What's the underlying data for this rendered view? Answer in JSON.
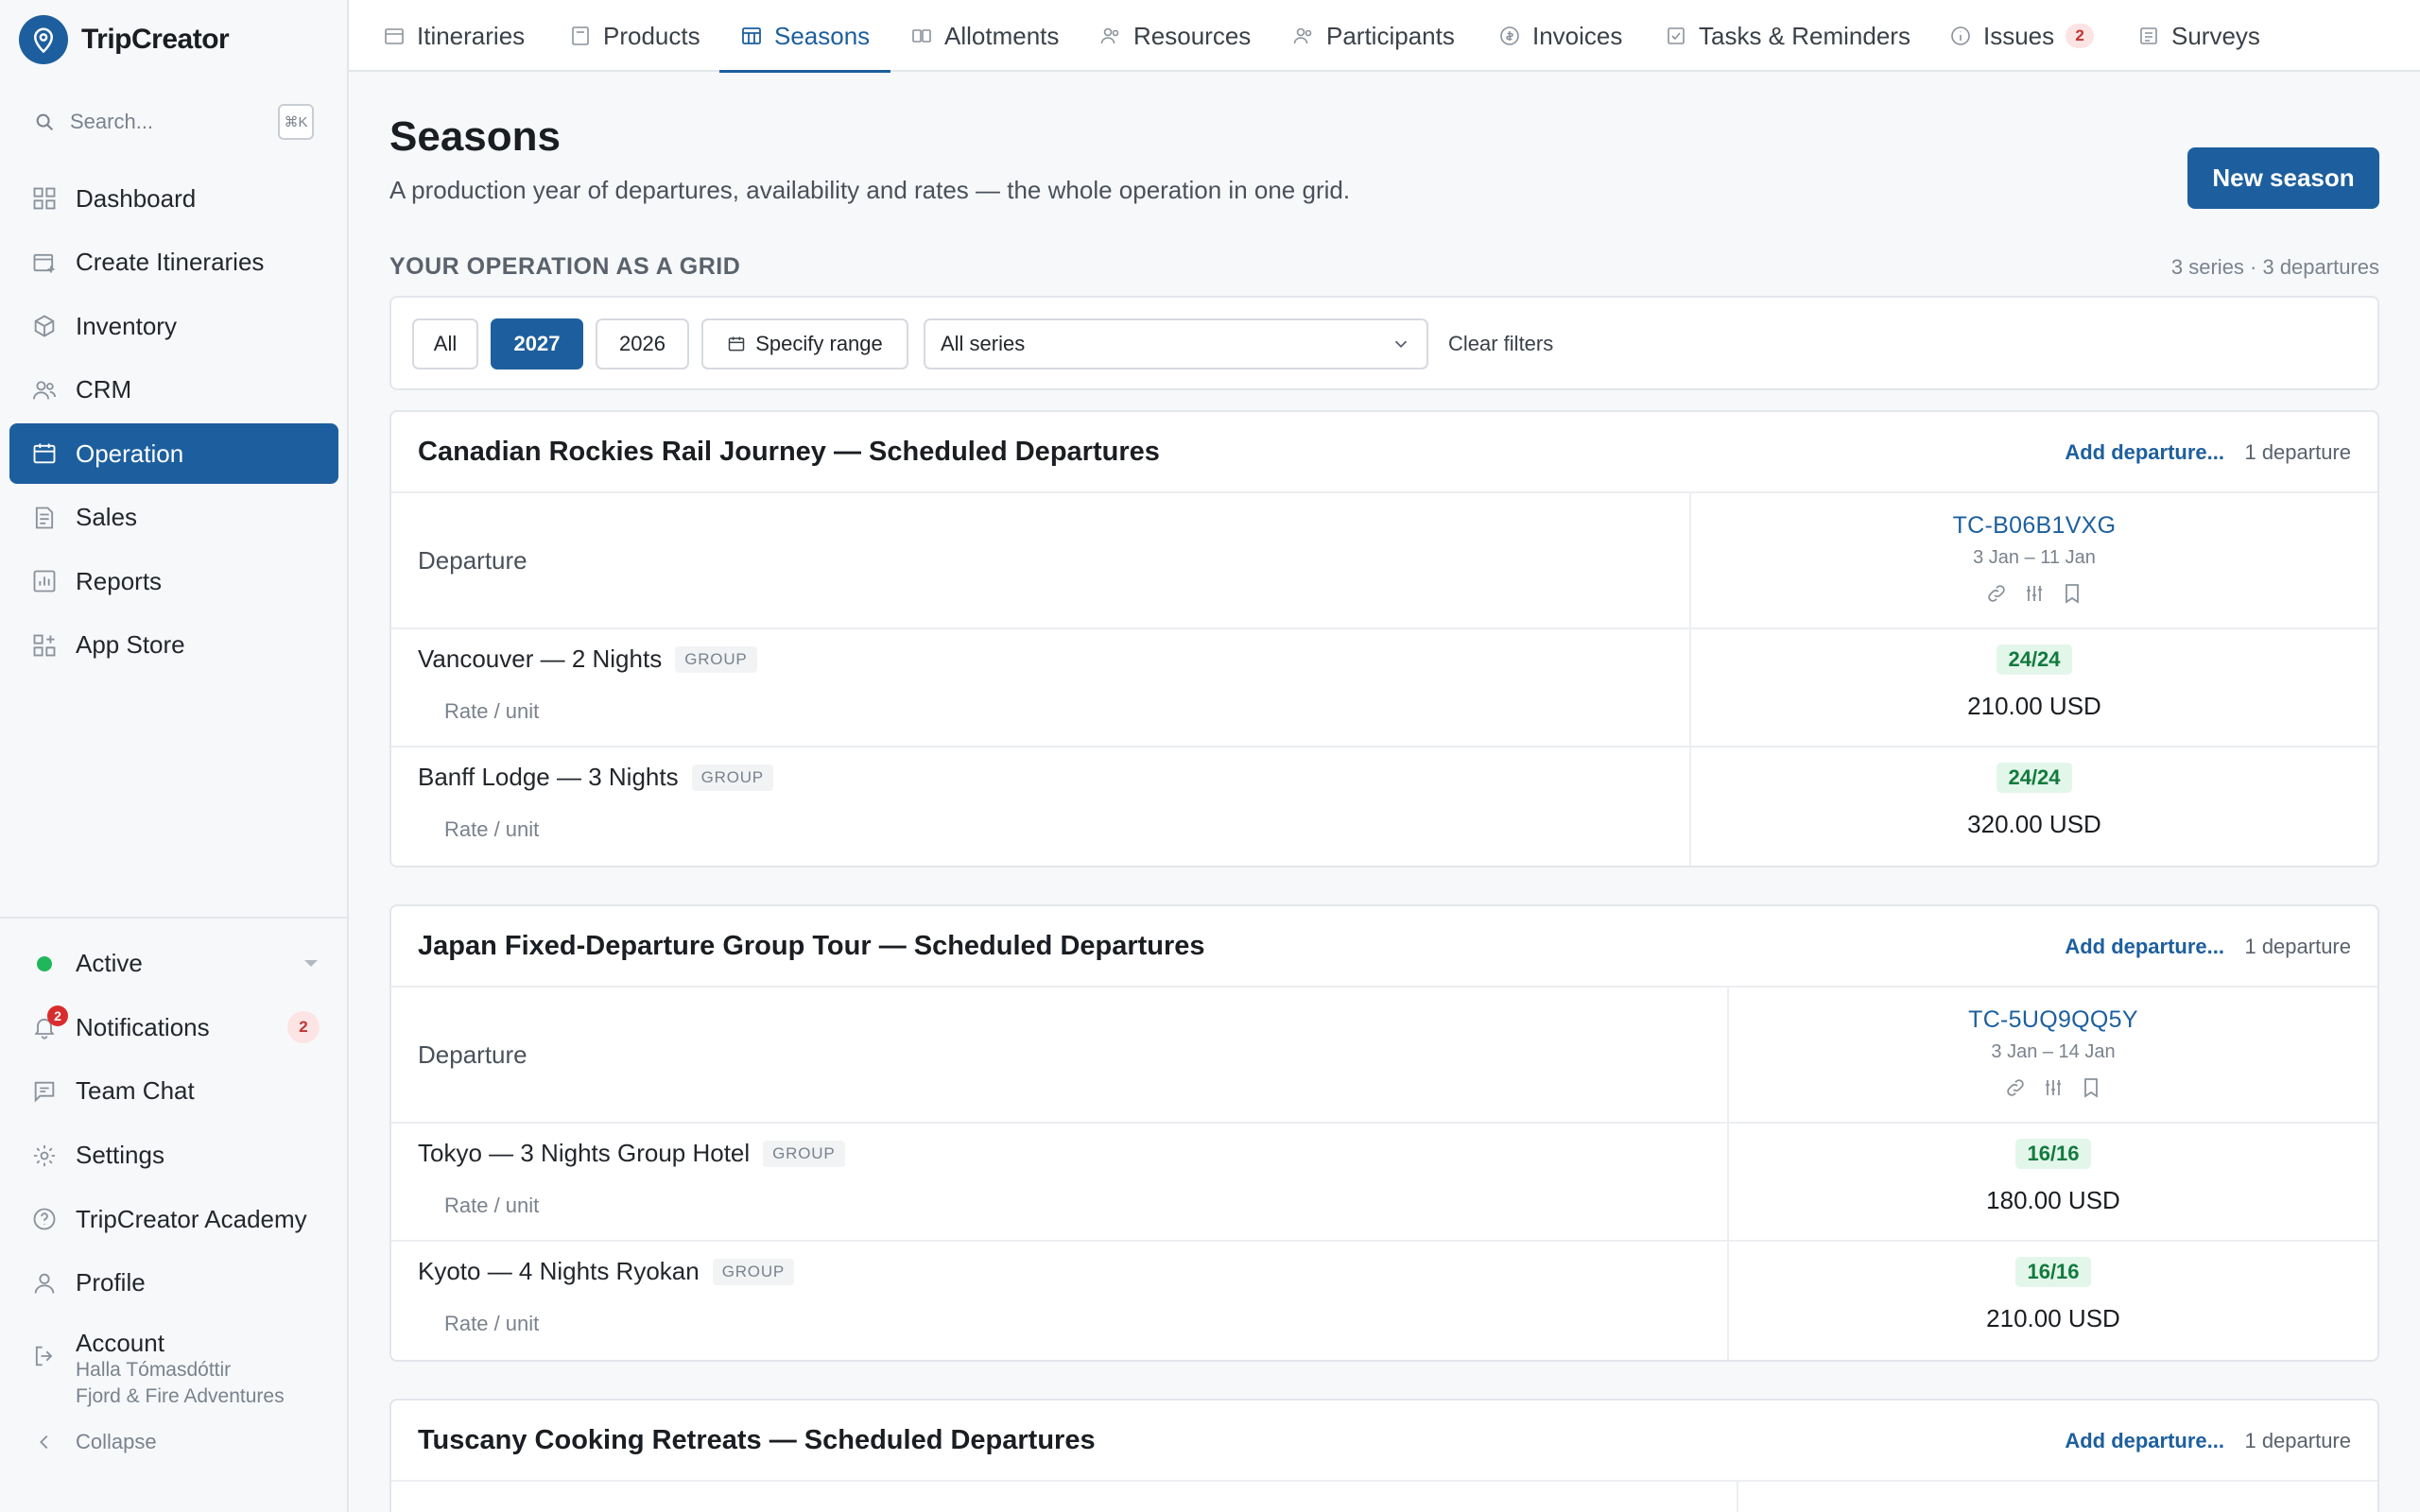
{
  "app": {
    "name": "TripCreator"
  },
  "search": {
    "placeholder": "Search...",
    "shortcut": "⌘K"
  },
  "sidebar": {
    "items": [
      {
        "label": "Dashboard",
        "icon": "dashboard-icon"
      },
      {
        "label": "Create Itineraries",
        "icon": "create-itinerary-icon"
      },
      {
        "label": "Inventory",
        "icon": "inventory-icon"
      },
      {
        "label": "CRM",
        "icon": "crm-icon"
      },
      {
        "label": "Operation",
        "icon": "operation-icon",
        "active": true
      },
      {
        "label": "Sales",
        "icon": "sales-icon"
      },
      {
        "label": "Reports",
        "icon": "reports-icon"
      },
      {
        "label": "App Store",
        "icon": "app-store-icon"
      }
    ],
    "bottom": {
      "status": "Active",
      "notifications": {
        "label": "Notifications",
        "count": "2",
        "dot": "2"
      },
      "team_chat": "Team Chat",
      "settings": "Settings",
      "academy": "TripCreator Academy",
      "profile": "Profile",
      "account": {
        "label": "Account",
        "user": "Halla Tómasdóttir",
        "company": "Fjord & Fire Adventures"
      },
      "collapse": "Collapse"
    }
  },
  "tabs": [
    {
      "label": "Itineraries"
    },
    {
      "label": "Products"
    },
    {
      "label": "Seasons",
      "active": true
    },
    {
      "label": "Allotments"
    },
    {
      "label": "Resources"
    },
    {
      "label": "Participants"
    },
    {
      "label": "Invoices"
    },
    {
      "label": "Tasks & Reminders"
    },
    {
      "label": "Issues",
      "badge": "2"
    },
    {
      "label": "Surveys"
    }
  ],
  "page": {
    "title": "Seasons",
    "subtitle": "A production year of departures, availability and rates — the whole operation in one grid.",
    "new_button": "New season",
    "section_label": "YOUR OPERATION AS A GRID",
    "section_meta": "3 series · 3 departures"
  },
  "filters": {
    "all": "All",
    "y2027": "2027",
    "y2026": "2026",
    "range": "Specify range",
    "series": "All series",
    "clear": "Clear filters"
  },
  "series": [
    {
      "title": "Canadian Rockies Rail Journey — Scheduled Departures",
      "add": "Add departure...",
      "count": "1 departure",
      "departure_label": "Departure",
      "departure": {
        "code": "TC-B06B1VXG",
        "dates": "3 Jan – 11 Jan"
      },
      "items": [
        {
          "name": "Vancouver — 2 Nights",
          "tag": "GROUP",
          "rate_label": "Rate / unit",
          "availability": "24/24",
          "price": "210.00 USD"
        },
        {
          "name": "Banff Lodge — 3 Nights",
          "tag": "GROUP",
          "rate_label": "Rate / unit",
          "availability": "24/24",
          "price": "320.00 USD"
        }
      ]
    },
    {
      "title": "Japan Fixed-Departure Group Tour — Scheduled Departures",
      "add": "Add departure...",
      "count": "1 departure",
      "departure_label": "Departure",
      "departure": {
        "code": "TC-5UQ9QQ5Y",
        "dates": "3 Jan – 14 Jan"
      },
      "items": [
        {
          "name": "Tokyo — 3 Nights Group Hotel",
          "tag": "GROUP",
          "rate_label": "Rate / unit",
          "availability": "16/16",
          "price": "180.00 USD"
        },
        {
          "name": "Kyoto — 4 Nights Ryokan",
          "tag": "GROUP",
          "rate_label": "Rate / unit",
          "availability": "16/16",
          "price": "210.00 USD"
        }
      ]
    },
    {
      "title": "Tuscany Cooking Retreats — Scheduled Departures",
      "add": "Add departure...",
      "count": "1 departure"
    }
  ],
  "colors": {
    "accent": "#1d5f9e",
    "status_green": "#1fb75a",
    "badge_red": "#d92d2d"
  }
}
